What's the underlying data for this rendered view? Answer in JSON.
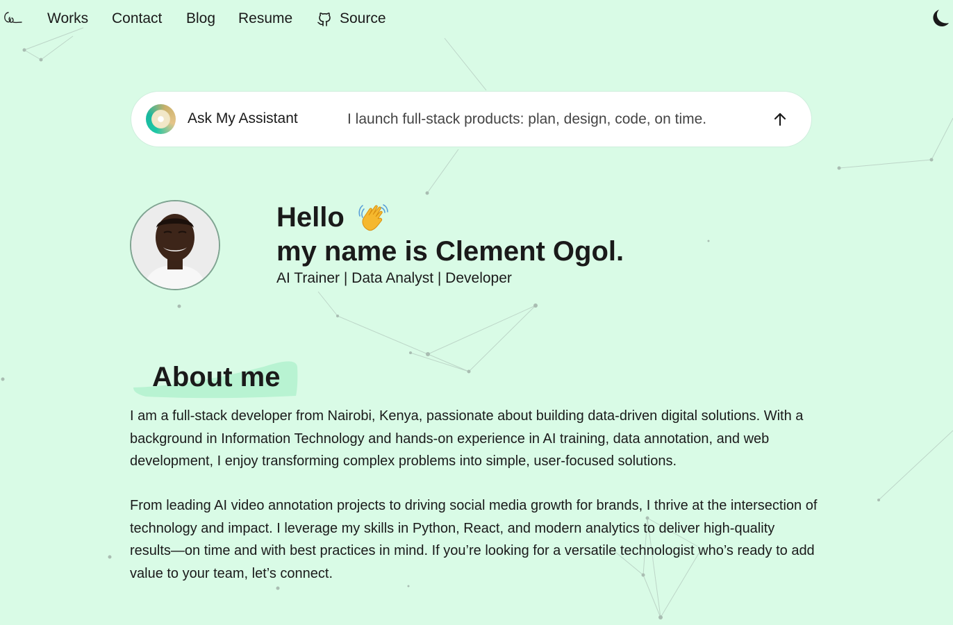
{
  "nav": {
    "logo_icon": "signature-logo-icon",
    "links": [
      "Works",
      "Contact",
      "Blog",
      "Resume"
    ],
    "source_label": "Source",
    "source_icon": "github-icon",
    "theme_icon": "moon-icon"
  },
  "assistant": {
    "label": "Ask My Assistant",
    "placeholder": "I launch full-stack products: plan, design, code, on time.",
    "send_icon": "arrow-up-icon"
  },
  "hero": {
    "greeting": "Hello",
    "wave_icon": "waving-hand-icon",
    "name_line": "my name is Clement Ogol.",
    "tagline": "AI Trainer | Data Analyst | Developer"
  },
  "about": {
    "title": "About me",
    "paragraphs": [
      "I am a full-stack developer from Nairobi, Kenya, passionate about building data-driven digital solutions. With a background in Information Technology and hands-on experience in AI training, data annotation, and web development, I enjoy transforming complex problems into simple, user-focused solutions.",
      "From leading AI video annotation projects to driving social media growth for brands, I thrive at the intersection of technology and impact. I leverage my skills in Python, React, and modern analytics to deliver high-quality results—on time and with best practices in mind. If you’re looking for a versatile technologist who’s ready to add value to your team, let’s connect."
    ]
  },
  "colors": {
    "background": "#d9fbe6",
    "accent": "#b8f3d2",
    "text": "#1a1a1a"
  }
}
